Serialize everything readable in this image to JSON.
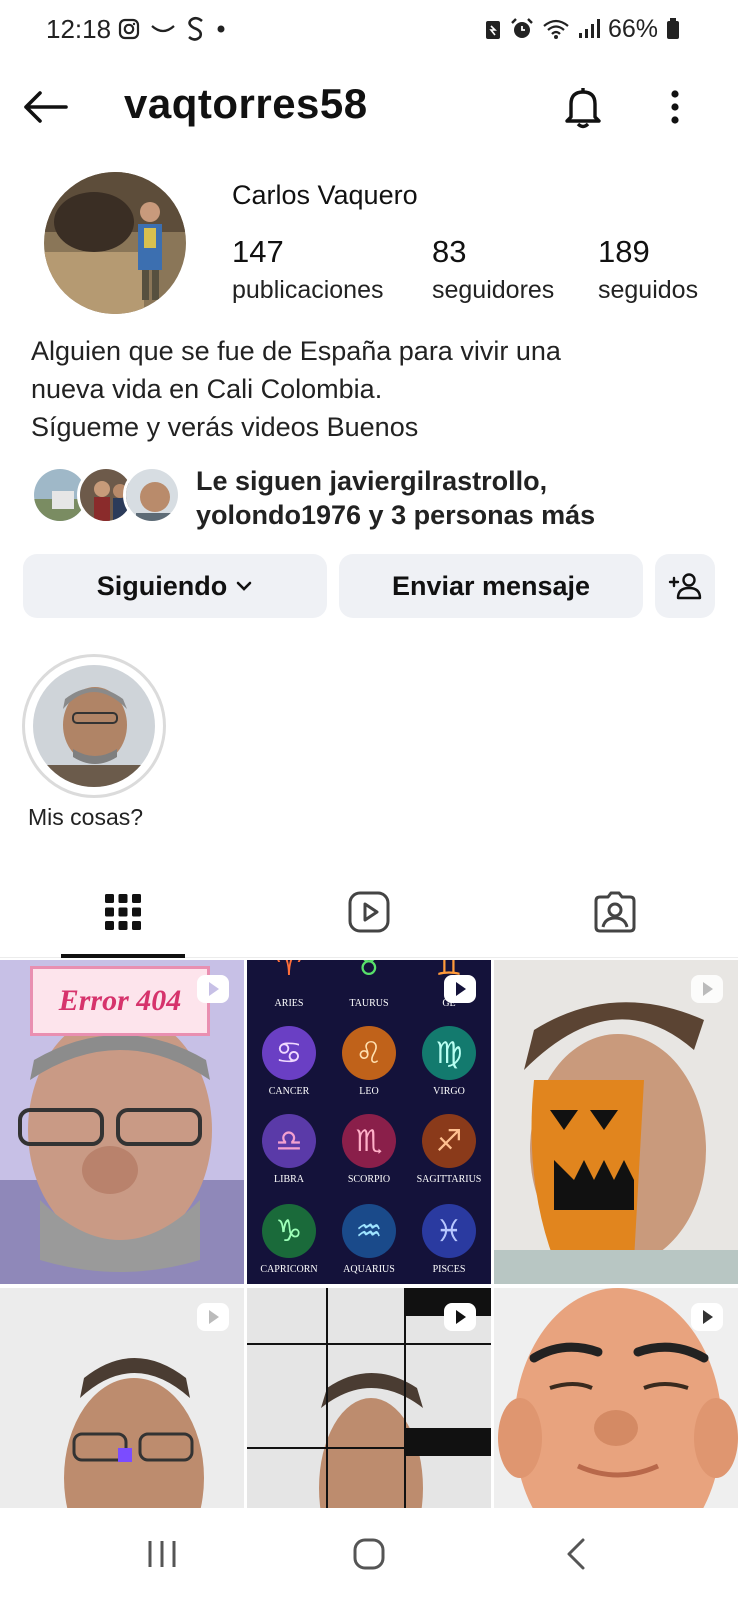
{
  "status_bar": {
    "time": "12:18",
    "battery": "66%",
    "left_icons": [
      "instagram-icon",
      "missed-call-icon",
      "s-app-icon",
      "dot-icon"
    ],
    "right_icons": [
      "battery-saver-icon",
      "alarm-icon",
      "wifi-icon",
      "signal-icon",
      "battery-icon"
    ]
  },
  "header": {
    "username": "vaqtorres58",
    "back_icon": "arrow-left-icon",
    "bell_icon": "bell-icon",
    "more_icon": "more-vertical-icon"
  },
  "profile": {
    "display_name": "Carlos Vaquero",
    "stats": [
      {
        "value": "147",
        "label": "publicaciones"
      },
      {
        "value": "83",
        "label": "seguidores"
      },
      {
        "value": "189",
        "label": "seguidos"
      }
    ],
    "bio": [
      "Alguien que se fue de España para vivir una",
      "nueva vida en Cali Colombia.",
      "Sígueme y verás videos Buenos"
    ],
    "followed_by": [
      "Le siguen javiergilrastrollo,",
      "yolondo1976 y 3 personas más"
    ]
  },
  "actions": {
    "following_label": "Siguiendo",
    "message_label": "Enviar mensaje",
    "add_icon": "add-person-icon"
  },
  "highlights": [
    {
      "label": "Mis cosas?"
    }
  ],
  "tabs": [
    {
      "icon": "grid-icon",
      "active": true
    },
    {
      "icon": "reels-icon",
      "active": false
    },
    {
      "icon": "tagged-icon",
      "active": false
    }
  ],
  "posts": {
    "error_text": "Error 404",
    "zodiac": [
      "ARIES",
      "TAURUS",
      "GE",
      "CANCER",
      "LEO",
      "VIRGO",
      "LIBRA",
      "SCORPIO",
      "SAGITTARIUS",
      "CAPRICORN",
      "AQUARIUS",
      "PISCES"
    ],
    "zodiac_glyphs": [
      "♈",
      "♉",
      "♊",
      "♋",
      "♌",
      "♍",
      "♎",
      "♏",
      "♐",
      "♑",
      "♒",
      "♓"
    ]
  },
  "nav_bar": {
    "icons": [
      "recent-apps-icon",
      "home-icon",
      "back-icon"
    ]
  },
  "colors": {
    "button_bg": "#eff1f5",
    "text": "#111111",
    "accent_pink": "#d6336c"
  }
}
